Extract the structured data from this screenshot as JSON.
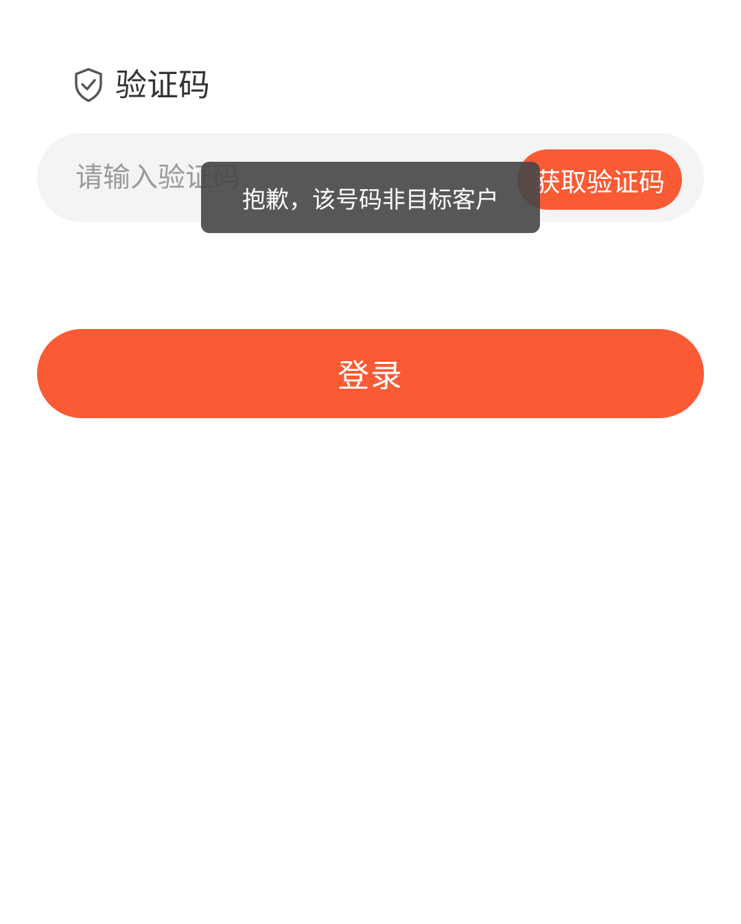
{
  "section": {
    "icon": "shield-check-icon",
    "title": "验证码"
  },
  "code_input": {
    "value": "",
    "placeholder": "请输入验证码"
  },
  "get_code_button": {
    "label": "获取验证码"
  },
  "login_button": {
    "label": "登录"
  },
  "toast": {
    "message": "抱歉，该号码非目标客户"
  },
  "colors": {
    "accent": "#fa5a34",
    "input_background": "#f4f4f4",
    "toast_background": "#464646",
    "title_text": "#333333",
    "placeholder_text": "#9a9a9a"
  }
}
